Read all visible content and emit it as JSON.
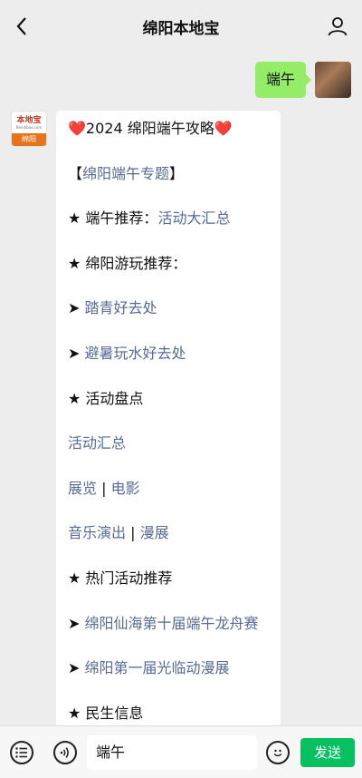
{
  "header": {
    "title": "绵阳本地宝"
  },
  "outgoing_message": {
    "text": "端午"
  },
  "bot": {
    "brand": "本地宝",
    "url": "Bendibao.com",
    "city": "绵阳"
  },
  "message": {
    "title": "2024 绵阳端午攻略",
    "heart": "❤️",
    "lines": [
      {
        "prefix": "【",
        "link": "绵阳端午专题",
        "suffix": "】"
      },
      {
        "prefix": "★ 端午推荐：",
        "link": "活动大汇总",
        "suffix": ""
      },
      {
        "prefix": "★ 绵阳游玩推荐：",
        "link": "",
        "suffix": ""
      },
      {
        "prefix": "➤ ",
        "link": "踏青好去处",
        "suffix": ""
      },
      {
        "prefix": "➤ ",
        "link": "避暑玩水好去处",
        "suffix": ""
      },
      {
        "prefix": "★ 活动盘点",
        "link": "",
        "suffix": ""
      },
      {
        "prefix": "",
        "link": "活动汇总",
        "suffix": ""
      },
      {
        "prefix": "",
        "link": "展览",
        "mid": " | ",
        "link2": "电影",
        "suffix": ""
      },
      {
        "prefix": "",
        "link": "音乐演出",
        "mid": " | ",
        "link2": "漫展",
        "suffix": ""
      },
      {
        "prefix": "★ 热门活动推荐",
        "link": "",
        "suffix": ""
      },
      {
        "prefix": "➤ ",
        "link": "绵阳仙海第十届端午龙舟赛",
        "suffix": ""
      },
      {
        "prefix": "➤ ",
        "link": "绵阳第一届光临动漫展",
        "suffix": ""
      },
      {
        "prefix": "★ 民生信息",
        "link": "",
        "suffix": ""
      }
    ]
  },
  "input": {
    "value": "端午"
  },
  "send_label": "发送",
  "colors": {
    "link": "#576b95",
    "send": "#07c160",
    "bubble_out": "#95ec69",
    "background": "#ededed"
  },
  "icons": [
    "back-icon",
    "profile-icon",
    "menu-icon",
    "voice-icon",
    "emoji-icon"
  ]
}
